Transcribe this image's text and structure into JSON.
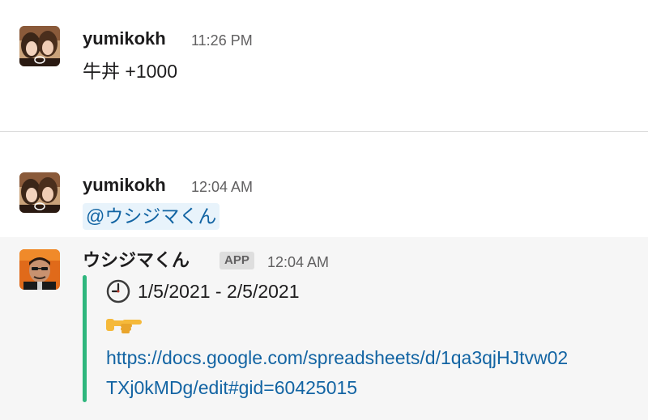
{
  "messages": [
    {
      "user": "yumikokh",
      "time": "11:26 PM",
      "text": "牛丼 +1000",
      "avatar_icon": "photo-avatar-icon"
    },
    {
      "user": "yumikokh",
      "time": "12:04 AM",
      "mention": "@ウシジマくん",
      "avatar_icon": "photo-avatar-icon"
    }
  ],
  "bot_message": {
    "user": "ウシジマくん",
    "badge": "APP",
    "time": "12:04 AM",
    "date_range": "1/5/2021 - 2/5/2021",
    "clock_icon": "clock-icon",
    "pointing_icon": "pointing-right-icon",
    "link_line1": "https://docs.google.com/spreadsheets/d/1qa3qjHJtvw02",
    "link_line2": "TXj0kMDg/edit#gid=60425015",
    "accent_color": "#2eb67d"
  },
  "colors": {
    "link": "#1264a3",
    "mention_bg": "#e8f3fb",
    "bot_bg": "#f6f6f6",
    "attachment_bar": "#2eb67d"
  }
}
